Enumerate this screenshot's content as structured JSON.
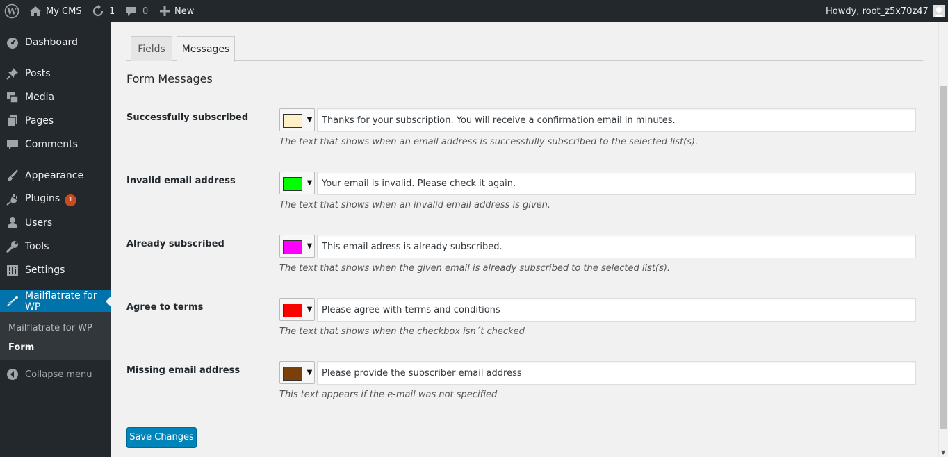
{
  "admin_bar": {
    "site_name": "My CMS",
    "updates_count": "1",
    "comments_count": "0",
    "new_label": "New",
    "howdy": "Howdy, root_z5x70z47"
  },
  "sidebar": {
    "items": [
      {
        "label": "Dashboard",
        "icon": "dashboard-icon"
      },
      {
        "label": "Posts",
        "icon": "pin-icon"
      },
      {
        "label": "Media",
        "icon": "media-icon"
      },
      {
        "label": "Pages",
        "icon": "pages-icon"
      },
      {
        "label": "Comments",
        "icon": "comment-icon"
      },
      {
        "label": "Appearance",
        "icon": "brush-icon"
      },
      {
        "label": "Plugins",
        "icon": "plug-icon",
        "badge": "1"
      },
      {
        "label": "Users",
        "icon": "user-icon"
      },
      {
        "label": "Tools",
        "icon": "wrench-icon"
      },
      {
        "label": "Settings",
        "icon": "settings-icon"
      },
      {
        "label": "Mailflatrate for WP",
        "icon": "mail-plane-icon",
        "current": true
      }
    ],
    "submenu": [
      {
        "label": "Mailflatrate for WP"
      },
      {
        "label": "Form",
        "current": true
      }
    ],
    "collapse_label": "Collapse menu"
  },
  "tabs": [
    {
      "label": "Fields"
    },
    {
      "label": "Messages",
      "active": true
    }
  ],
  "form": {
    "title": "Form Messages",
    "rows": [
      {
        "label": "Successfully subscribed",
        "color": "#fff0c8",
        "value": "Thanks for your subscription. You will receive a confirmation email in minutes.",
        "description": "The text that shows when an email address is successfully subscribed to the selected list(s)."
      },
      {
        "label": "Invalid email address",
        "color": "#00ff00",
        "value": "Your email is invalid. Please check it again.",
        "description": "The text that shows when an invalid email address is given."
      },
      {
        "label": "Already subscribed",
        "color": "#ff00ff",
        "value": "This email adress is already subscribed.",
        "description": "The text that shows when the given email is already subscribed to the selected list(s)."
      },
      {
        "label": "Agree to terms",
        "color": "#ff0000",
        "value": "Please agree with terms and conditions",
        "description": "The text that shows when the checkbox isn´t checked"
      },
      {
        "label": "Missing email address",
        "color": "#7a3f0a",
        "value": "Please provide the subscriber email address",
        "description": "This text appears if the e-mail was not specified"
      }
    ],
    "save_label": "Save Changes"
  },
  "colors": {
    "admin_dark": "#23282d",
    "accent_blue": "#0073aa",
    "button_blue": "#0085ba",
    "badge_orange": "#ca4a1f"
  }
}
